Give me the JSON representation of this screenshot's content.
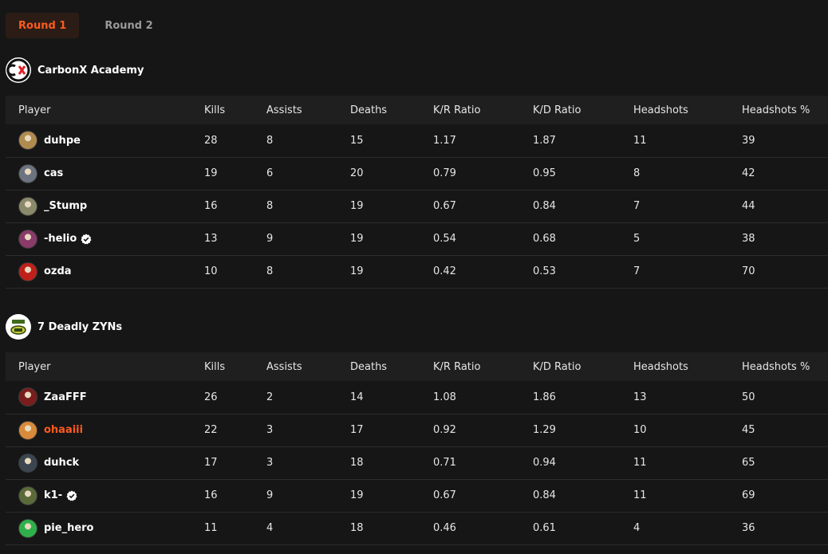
{
  "tabs": [
    {
      "label": "Round 1",
      "active": true
    },
    {
      "label": "Round 2",
      "active": false
    }
  ],
  "columns": [
    "Player",
    "Kills",
    "Assists",
    "Deaths",
    "K/R Ratio",
    "K/D Ratio",
    "Headshots",
    "Headshots %"
  ],
  "teams": [
    {
      "name": "CarbonX Academy",
      "logo_icon": "carbonx-logo",
      "players": [
        {
          "name": "duhpe",
          "verified": false,
          "highlight": false,
          "kills": "28",
          "assists": "8",
          "deaths": "15",
          "kr": "1.17",
          "kd": "1.87",
          "hs": "11",
          "hsp": "39",
          "avatar_color": "#b08b4f"
        },
        {
          "name": "cas",
          "verified": false,
          "highlight": false,
          "kills": "19",
          "assists": "6",
          "deaths": "20",
          "kr": "0.79",
          "kd": "0.95",
          "hs": "8",
          "hsp": "42",
          "avatar_color": "#6c7480"
        },
        {
          "name": "_Stump",
          "verified": false,
          "highlight": false,
          "kills": "16",
          "assists": "8",
          "deaths": "19",
          "kr": "0.67",
          "kd": "0.84",
          "hs": "7",
          "hsp": "44",
          "avatar_color": "#8a8a6a"
        },
        {
          "name": "-helio",
          "verified": true,
          "highlight": false,
          "kills": "13",
          "assists": "9",
          "deaths": "19",
          "kr": "0.54",
          "kd": "0.68",
          "hs": "5",
          "hsp": "38",
          "avatar_color": "#8a3b6a"
        },
        {
          "name": "ozda",
          "verified": false,
          "highlight": false,
          "kills": "10",
          "assists": "8",
          "deaths": "19",
          "kr": "0.42",
          "kd": "0.53",
          "hs": "7",
          "hsp": "70",
          "avatar_color": "#c0201a"
        }
      ]
    },
    {
      "name": "7 Deadly ZYNs",
      "logo_icon": "zyn-logo",
      "players": [
        {
          "name": "ZaaFFF",
          "verified": false,
          "highlight": false,
          "kills": "26",
          "assists": "2",
          "deaths": "14",
          "kr": "1.08",
          "kd": "1.86",
          "hs": "13",
          "hsp": "50",
          "avatar_color": "#7a1d1d"
        },
        {
          "name": "ohaaiii",
          "verified": false,
          "highlight": true,
          "kills": "22",
          "assists": "3",
          "deaths": "17",
          "kr": "0.92",
          "kd": "1.29",
          "hs": "10",
          "hsp": "45",
          "avatar_color": "#d98a3a"
        },
        {
          "name": "duhck",
          "verified": false,
          "highlight": false,
          "kills": "17",
          "assists": "3",
          "deaths": "18",
          "kr": "0.71",
          "kd": "0.94",
          "hs": "11",
          "hsp": "65",
          "avatar_color": "#3c4650"
        },
        {
          "name": "k1-",
          "verified": true,
          "highlight": false,
          "kills": "16",
          "assists": "9",
          "deaths": "19",
          "kr": "0.67",
          "kd": "0.84",
          "hs": "11",
          "hsp": "69",
          "avatar_color": "#5a6a3a"
        },
        {
          "name": "pie_hero",
          "verified": false,
          "highlight": false,
          "kills": "11",
          "assists": "4",
          "deaths": "18",
          "kr": "0.46",
          "kd": "0.61",
          "hs": "4",
          "hsp": "36",
          "avatar_color": "#2fb04a"
        }
      ]
    }
  ],
  "colors": {
    "accent": "#ff5a1f",
    "background": "#161616",
    "header_row": "#1f1f1f",
    "divider": "#2c2c2c"
  }
}
